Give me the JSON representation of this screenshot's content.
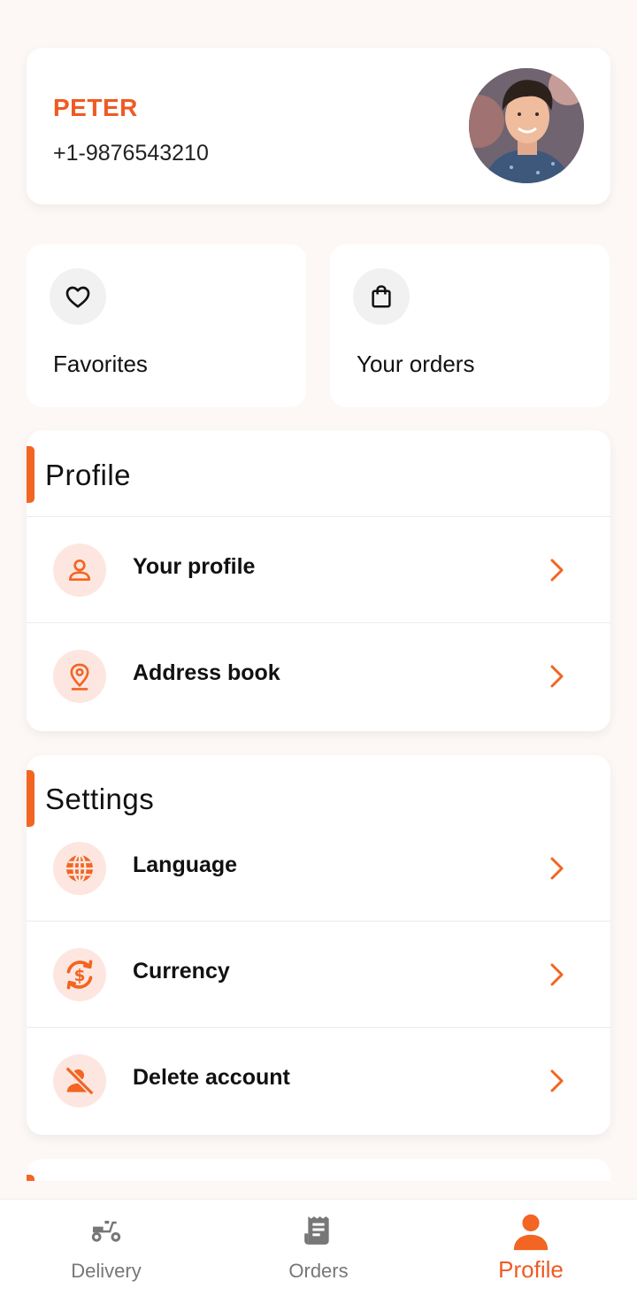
{
  "user": {
    "name": "PETER",
    "phone": "+1-9876543210"
  },
  "quick_tiles": [
    {
      "label": "Favorites",
      "icon": "heart-icon"
    },
    {
      "label": "Your orders",
      "icon": "shopping-bag-icon"
    }
  ],
  "sections": {
    "profile": {
      "title": "Profile",
      "items": [
        {
          "label": "Your profile",
          "icon": "person-icon"
        },
        {
          "label": "Address book",
          "icon": "location-pin-icon"
        }
      ]
    },
    "settings": {
      "title": "Settings",
      "items": [
        {
          "label": "Language",
          "icon": "globe-icon"
        },
        {
          "label": "Currency",
          "icon": "currency-exchange-icon"
        },
        {
          "label": "Delete account",
          "icon": "person-off-icon"
        }
      ]
    }
  },
  "bottom_nav": [
    {
      "label": "Delivery",
      "icon": "scooter-icon",
      "active": false
    },
    {
      "label": "Orders",
      "icon": "receipt-icon",
      "active": false
    },
    {
      "label": "Profile",
      "icon": "person-icon",
      "active": true
    }
  ],
  "colors": {
    "accent": "#f26522",
    "accent_text": "#f05a22",
    "icon_bg": "#fde6e0",
    "page_bg": "#fdf8f6"
  }
}
